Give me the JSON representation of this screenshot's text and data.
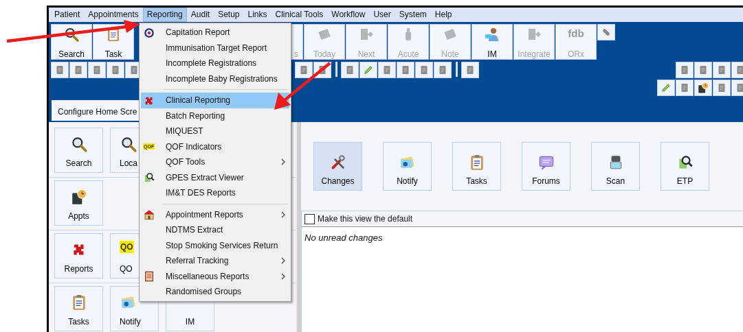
{
  "menu_bar": [
    {
      "label": "Patient",
      "selected": false
    },
    {
      "label": "Appointments",
      "selected": false
    },
    {
      "label": "Reporting",
      "selected": true
    },
    {
      "label": "Audit",
      "selected": false
    },
    {
      "label": "Setup",
      "selected": false
    },
    {
      "label": "Links",
      "selected": false
    },
    {
      "label": "Clinical Tools",
      "selected": false
    },
    {
      "label": "Workflow",
      "selected": false
    },
    {
      "label": "User",
      "selected": false
    },
    {
      "label": "System",
      "selected": false
    },
    {
      "label": "Help",
      "selected": false
    }
  ],
  "toolbar": {
    "buttons": [
      {
        "label": "Search",
        "disabled": false
      },
      {
        "label": "Task",
        "disabled": false
      },
      {
        "label": "s",
        "disabled": true
      },
      {
        "label": "Today",
        "disabled": true
      },
      {
        "label": "Next",
        "disabled": true
      },
      {
        "label": "Acute",
        "disabled": true
      },
      {
        "label": "Note",
        "disabled": true
      },
      {
        "label": "IM",
        "disabled": false
      },
      {
        "label": "Integrate",
        "disabled": true
      },
      {
        "label": "ORx",
        "disabled": true,
        "icon_text": "fdb"
      }
    ]
  },
  "tab": {
    "label": "Configure Home Scre"
  },
  "left_panel": {
    "rows": [
      [
        {
          "label": "Search"
        },
        {
          "label": "Loca"
        }
      ],
      [
        {
          "label": "Appts"
        }
      ],
      [
        {
          "label": "Reports"
        },
        {
          "label": "QO",
          "icon_text": "QO"
        }
      ],
      [
        {
          "label": "Tasks"
        },
        {
          "label": "Notify"
        },
        {
          "label": "IM"
        }
      ]
    ]
  },
  "home_tiles": [
    {
      "label": "Changes",
      "selected": true
    },
    {
      "label": "Notify",
      "selected": false
    },
    {
      "label": "Tasks",
      "selected": false
    },
    {
      "label": "Forums",
      "selected": false
    },
    {
      "label": "Scan",
      "selected": false
    },
    {
      "label": "ETP",
      "selected": false
    }
  ],
  "changes_panel": {
    "default_checkbox": {
      "label": "Make this view the default",
      "checked": false
    },
    "message": "No unread changes"
  },
  "reporting_menu": [
    {
      "kind": "item",
      "label": "Capitation Report",
      "selected": false,
      "submenu": false
    },
    {
      "kind": "item",
      "label": "Immunisation Target Report",
      "selected": false,
      "submenu": false
    },
    {
      "kind": "item",
      "label": "Incomplete Registrations",
      "selected": false,
      "submenu": false
    },
    {
      "kind": "item",
      "label": "Incomplete Baby Registrations",
      "selected": false,
      "submenu": false
    },
    {
      "kind": "separator"
    },
    {
      "kind": "item",
      "label": "Clinical Reporting",
      "selected": true,
      "submenu": false
    },
    {
      "kind": "item",
      "label": "Batch Reporting",
      "selected": false,
      "submenu": false
    },
    {
      "kind": "item",
      "label": "MIQUEST",
      "selected": false,
      "submenu": false
    },
    {
      "kind": "item",
      "label": "QOF Indicators",
      "selected": false,
      "submenu": false,
      "icon_text": "QOF"
    },
    {
      "kind": "item",
      "label": "QOF Tools",
      "selected": false,
      "submenu": true
    },
    {
      "kind": "item",
      "label": "GPES Extract Viewer",
      "selected": false,
      "submenu": false
    },
    {
      "kind": "item",
      "label": "IM&T DES Reports",
      "selected": false,
      "submenu": false
    },
    {
      "kind": "separator"
    },
    {
      "kind": "item",
      "label": "Appointment Reports",
      "selected": false,
      "submenu": true
    },
    {
      "kind": "item",
      "label": "NDTMS Extract",
      "selected": false,
      "submenu": false
    },
    {
      "kind": "item",
      "label": "Stop Smoking Services Return",
      "selected": false,
      "submenu": false
    },
    {
      "kind": "item",
      "label": "Referral Tracking",
      "selected": false,
      "submenu": true
    },
    {
      "kind": "item",
      "label": "Miscellaneous Reports",
      "selected": false,
      "submenu": true
    },
    {
      "kind": "item",
      "label": "Randomised Groups",
      "selected": false,
      "submenu": false
    }
  ]
}
